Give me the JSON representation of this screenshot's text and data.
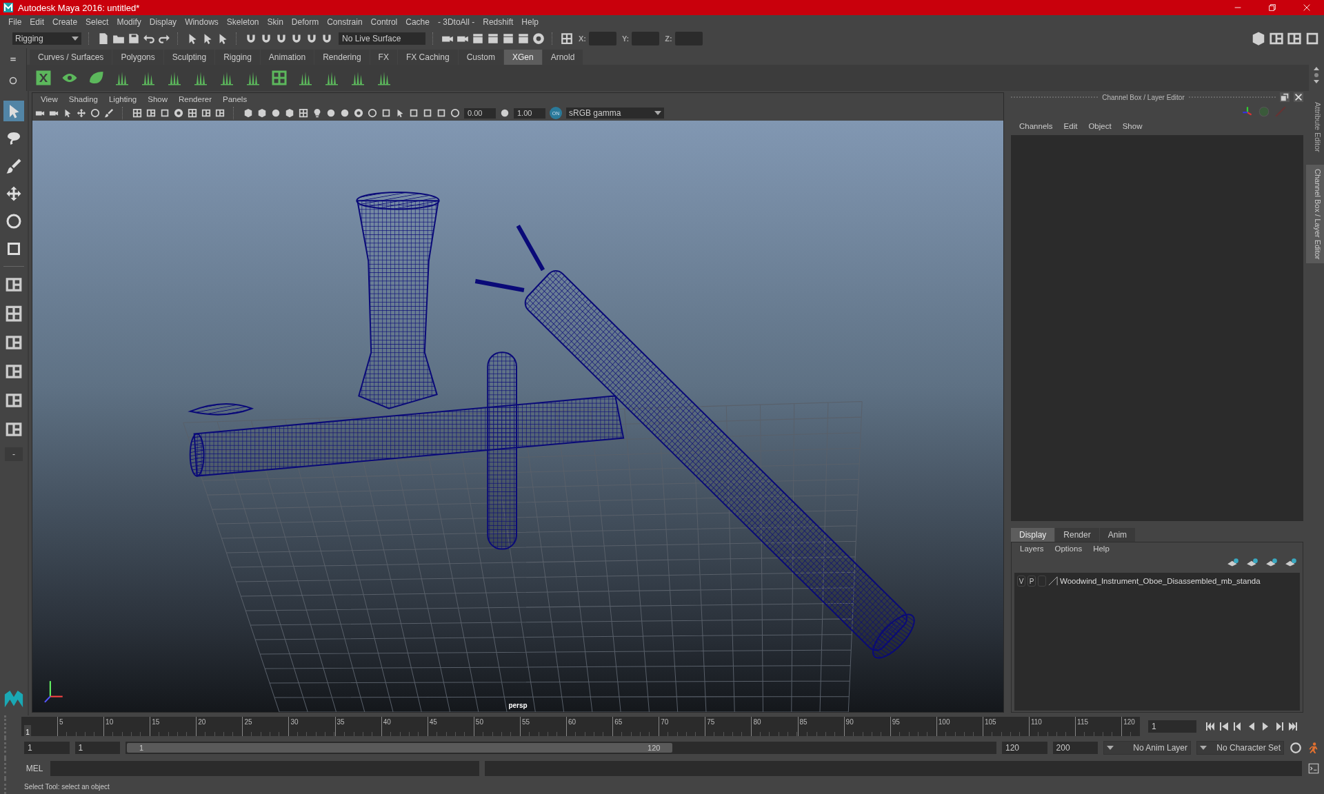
{
  "window": {
    "title": "Autodesk Maya 2016: untitled*"
  },
  "menu_bar": [
    "File",
    "Edit",
    "Create",
    "Select",
    "Modify",
    "Display",
    "Windows",
    "Skeleton",
    "Skin",
    "Deform",
    "Constrain",
    "Control",
    "Cache",
    "- 3DtoAll -",
    "Redshift",
    "Help"
  ],
  "toolbar": {
    "menu_set": "Rigging",
    "live_surface": "No Live Surface",
    "x_label": "X:",
    "y_label": "Y:",
    "z_label": "Z:"
  },
  "shelf_tabs": [
    {
      "label": "Curves / Surfaces",
      "selected": false
    },
    {
      "label": "Polygons",
      "selected": false
    },
    {
      "label": "Sculpting",
      "selected": false
    },
    {
      "label": "Rigging",
      "selected": false
    },
    {
      "label": "Animation",
      "selected": false
    },
    {
      "label": "Rendering",
      "selected": false
    },
    {
      "label": "FX",
      "selected": false
    },
    {
      "label": "FX Caching",
      "selected": false
    },
    {
      "label": "Custom",
      "selected": false
    },
    {
      "label": "XGen",
      "selected": true
    },
    {
      "label": "Arnold",
      "selected": false
    }
  ],
  "toolbox": [
    {
      "selected": true
    },
    {
      "selected": false
    },
    {
      "selected": false
    },
    {
      "selected": false
    },
    {
      "selected": false
    },
    {
      "selected": false
    }
  ],
  "toolbox_collapse": "-",
  "panel_menu": [
    "View",
    "Shading",
    "Lighting",
    "Show",
    "Renderer",
    "Panels"
  ],
  "panel_toolbar": {
    "exposure": "0.00",
    "gamma": "1.00",
    "color_management": "ON",
    "color_space": "sRGB gamma"
  },
  "viewport": {
    "camera": "persp"
  },
  "channel_box": {
    "title": "Channel Box / Layer Editor",
    "menu": [
      "Channels",
      "Edit",
      "Object",
      "Show"
    ]
  },
  "side_tabs": [
    {
      "label": "Attribute Editor",
      "selected": false
    },
    {
      "label": "Channel Box / Layer Editor",
      "selected": true
    }
  ],
  "layer_editor": {
    "tabs": [
      {
        "label": "Display",
        "selected": true
      },
      {
        "label": "Render",
        "selected": false
      },
      {
        "label": "Anim",
        "selected": false
      }
    ],
    "menu": [
      "Layers",
      "Options",
      "Help"
    ],
    "layers": [
      {
        "visible": "V",
        "playback": "P",
        "name": "Woodwind_Instrument_Oboe_Disassembled_mb_standa"
      }
    ]
  },
  "timeline": {
    "current_marker": "1",
    "ticks": [
      "5",
      "10",
      "15",
      "20",
      "25",
      "30",
      "35",
      "40",
      "45",
      "50",
      "55",
      "60",
      "65",
      "70",
      "75",
      "80",
      "85",
      "90",
      "95",
      "100",
      "105",
      "110",
      "115",
      "120"
    ],
    "current_frame": "1"
  },
  "range": {
    "start": "1",
    "playback_start": "1",
    "slider_start": "1",
    "slider_end": "120",
    "level": 0.6,
    "playback_end": "120",
    "end": "200",
    "anim_layer": "No Anim Layer",
    "character_set": "No Character Set"
  },
  "command_line": {
    "label": "MEL"
  },
  "status_bar": "Select Tool: select an object"
}
